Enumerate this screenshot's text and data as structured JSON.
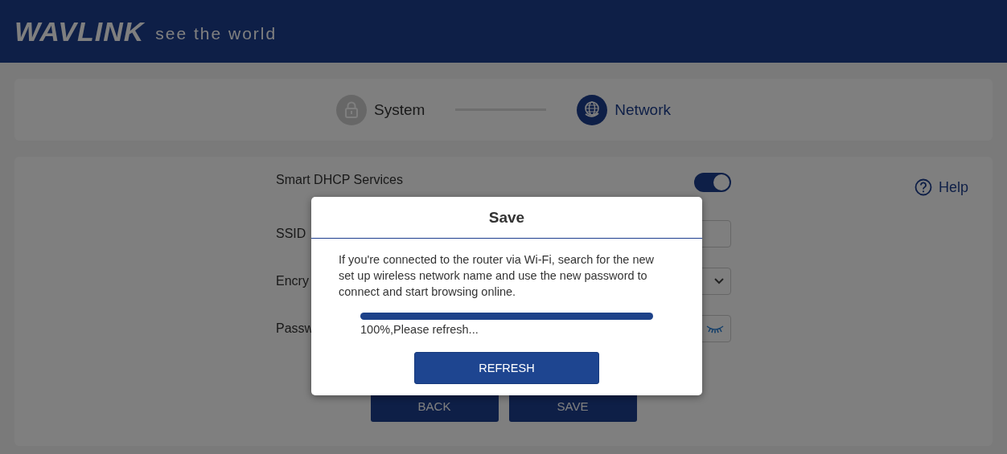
{
  "header": {
    "logo": "WAVLINK",
    "tagline": "see the world"
  },
  "steps": [
    {
      "label": "System",
      "selected": false
    },
    {
      "label": "Network",
      "selected": true
    }
  ],
  "help": "Help",
  "rows": [
    {
      "kind": "toggle",
      "label": "Smart DHCP Services",
      "on": true
    },
    {
      "kind": "text",
      "label": "SSID"
    },
    {
      "kind": "select",
      "label": "Encry"
    },
    {
      "kind": "password",
      "label": "Passw"
    }
  ],
  "buttons": [
    "BACK",
    "SAVE"
  ],
  "dialog": {
    "title": "Save",
    "message": "If you're connected to the router via Wi-Fi, search for the new set up wireless network name and use the new password to connect and start browsing online.",
    "level": 1,
    "status": "100%,Please refresh...",
    "button": "REFRESH"
  }
}
